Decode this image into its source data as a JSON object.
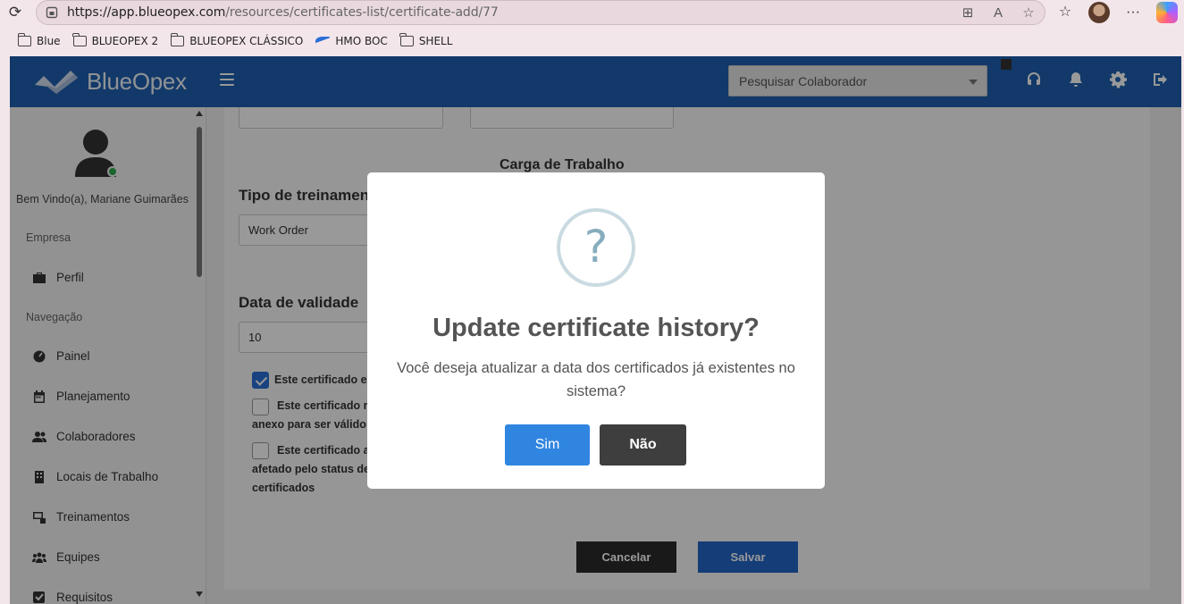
{
  "browser": {
    "url_main": "https://app.blueopex.com",
    "url_path": "/resources/certificates-list/certificate-add/77",
    "bookmarks": [
      "Blue",
      "BLUEOPEX 2",
      "BLUEOPEX CLÁSSICO",
      "HMO BOC",
      "SHELL"
    ],
    "more_label": "···"
  },
  "header": {
    "logo_text": "BlueOpex",
    "search_placeholder": "Pesquisar Colaborador"
  },
  "sidebar": {
    "welcome": "Bem Vindo(a), Mariane Guimarães",
    "section_company": "Empresa",
    "section_nav": "Navegação",
    "items": [
      {
        "label": "Perfil",
        "icon": "briefcase-icon"
      },
      {
        "label": "Painel",
        "icon": "dashboard-icon"
      },
      {
        "label": "Planejamento",
        "icon": "calendar-icon"
      },
      {
        "label": "Colaboradores",
        "icon": "users-icon"
      },
      {
        "label": "Locais de Trabalho",
        "icon": "building-icon"
      },
      {
        "label": "Treinamentos",
        "icon": "training-icon"
      },
      {
        "label": "Equipes",
        "icon": "team-icon"
      },
      {
        "label": "Requisitos",
        "icon": "checkbox-icon"
      }
    ]
  },
  "form": {
    "workload_label": "Carga de Trabalho",
    "training_type_label": "Tipo de treinament",
    "training_type_value": "Work Order",
    "validity_label": "Data de validade",
    "validity_value": "10",
    "check1_text": "Este certificado ex",
    "check1_checked": true,
    "check2_line1": "Este certificado r",
    "check2_line2": "anexo para ser válido",
    "check2_checked": false,
    "check3_line1": "Este certificado a",
    "check3_line2": "afetado pelo status de",
    "check3_line3": "certificados",
    "check3_checked": false,
    "cancel_label": "Cancelar",
    "save_label": "Salvar"
  },
  "modal": {
    "icon_glyph": "?",
    "title": "Update certificate history?",
    "text": "Você deseja atualizar a data dos certificados já existentes no sistema?",
    "yes_label": "Sim",
    "no_label": "Não"
  },
  "colors": {
    "topbar": "#1f5fb0",
    "confirm": "#3085e0",
    "deny": "#3e3e3e"
  }
}
